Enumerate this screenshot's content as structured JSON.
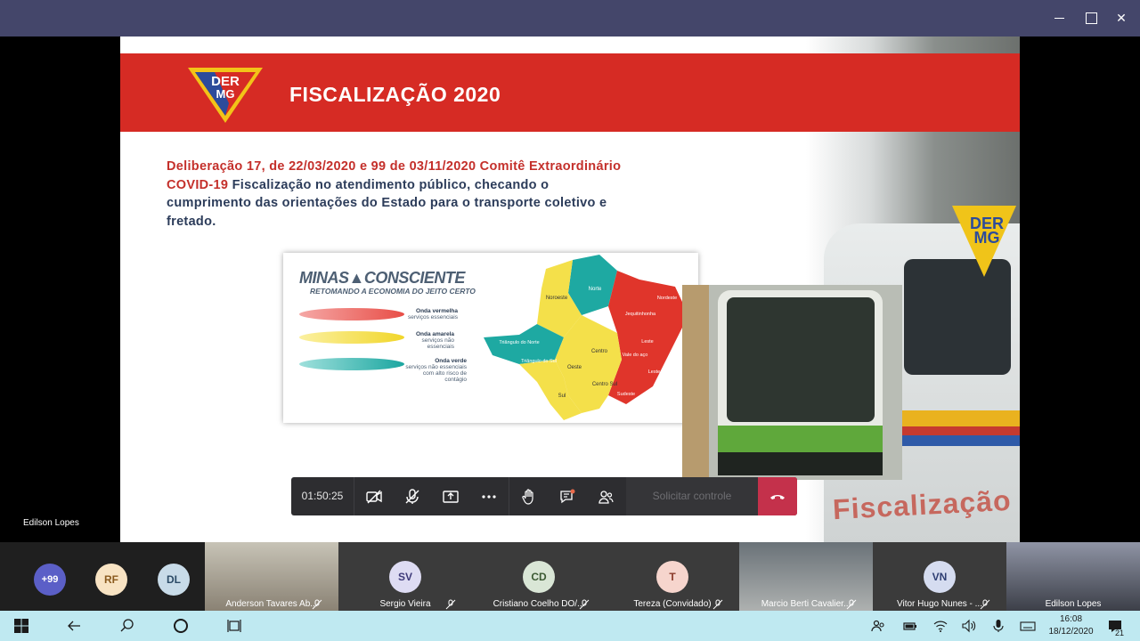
{
  "window": {
    "minimize_label": "—",
    "maximize_label": "",
    "close_label": "✕"
  },
  "slide": {
    "logo_text_1": "DER",
    "logo_text_2": "MG",
    "title": "FISCALIZAÇÃO 2020",
    "body_red": "Deliberação 17, de 22/03/2020 e 99 de 03/11/2020 Comitê Extraordinário COVID-19 ",
    "body_dark": " Fiscalização no atendimento público, checando o cumprimento das orientações do Estado para o transporte coletivo e fretado.",
    "minas_title": "MINAS▲CONSCIENTE",
    "minas_subtitle": "RETOMANDO A ECONOMIA DO JEITO CERTO",
    "waves": [
      {
        "title": "Onda vermelha",
        "desc": "serviços essenciais"
      },
      {
        "title": "Onda amarela",
        "desc": "serviços não essenciais"
      },
      {
        "title": "Onda verde",
        "desc": "serviços não essenciais com alto risco de contágio"
      }
    ],
    "regions": [
      "Norte",
      "Noroeste",
      "Nordeste",
      "Jequitinhonha",
      "Triângulo do Norte",
      "Triângulo do Sul",
      "Centro",
      "Oeste",
      "Leste",
      "Vale do aço",
      "Leste do Sul",
      "Centro Sul",
      "Sudeste",
      "Sul"
    ],
    "van_badge_1": "DER",
    "van_badge_2": "MG",
    "van_text": "Fiscalização",
    "colors": {
      "red_band": "#d62b24",
      "body_text": "#2c3c5a",
      "body_red": "#c4302b"
    }
  },
  "controls": {
    "timer": "01:50:25",
    "request_control": "Solicitar controle",
    "icons": [
      "camera-off-icon",
      "mic-off-icon",
      "share-icon",
      "more-icon",
      "raise-hand-icon",
      "chat-icon",
      "participants-icon",
      "hangup-icon"
    ]
  },
  "presenter": "Edilson Lopes",
  "participants": {
    "overflow": "+99",
    "avatars": [
      "RF",
      "DL"
    ],
    "tiles": [
      {
        "name": "Anderson Tavares Ab...",
        "initials": ""
      },
      {
        "name": "Sergio Vieira",
        "initials": "SV"
      },
      {
        "name": "Cristiano Coelho DO/...",
        "initials": "CD"
      },
      {
        "name": "Tereza (Convidado)",
        "initials": "T"
      },
      {
        "name": "Marcio Berti Cavalier...",
        "initials": ""
      },
      {
        "name": "Vitor Hugo Nunes - ...",
        "initials": "VN"
      },
      {
        "name": "Edilson Lopes",
        "initials": ""
      }
    ]
  },
  "taskbar": {
    "time": "16:08",
    "date": "18/12/2020",
    "notifications": "21"
  }
}
